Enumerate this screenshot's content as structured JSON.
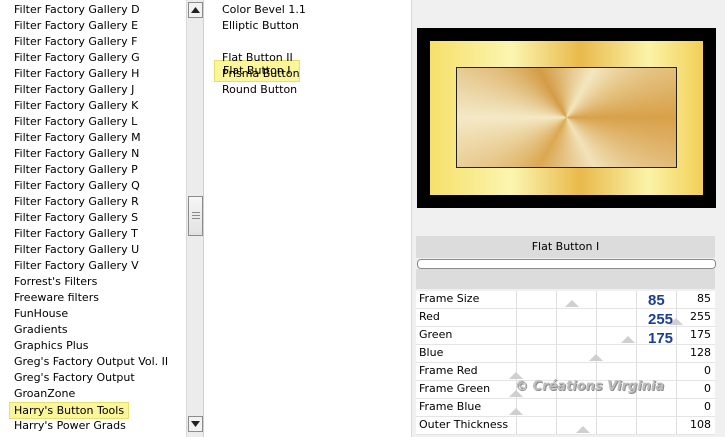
{
  "categories": [
    {
      "label": "Filter Factory Gallery D"
    },
    {
      "label": "Filter Factory Gallery E"
    },
    {
      "label": "Filter Factory Gallery F"
    },
    {
      "label": "Filter Factory Gallery G"
    },
    {
      "label": "Filter Factory Gallery H"
    },
    {
      "label": "Filter Factory Gallery J"
    },
    {
      "label": "Filter Factory Gallery K"
    },
    {
      "label": "Filter Factory Gallery L"
    },
    {
      "label": "Filter Factory Gallery M"
    },
    {
      "label": "Filter Factory Gallery N"
    },
    {
      "label": "Filter Factory Gallery P"
    },
    {
      "label": "Filter Factory Gallery Q"
    },
    {
      "label": "Filter Factory Gallery R"
    },
    {
      "label": "Filter Factory Gallery S"
    },
    {
      "label": "Filter Factory Gallery T"
    },
    {
      "label": "Filter Factory Gallery U"
    },
    {
      "label": "Filter Factory Gallery V"
    },
    {
      "label": "Forrest's Filters"
    },
    {
      "label": "Freeware filters"
    },
    {
      "label": "FunHouse"
    },
    {
      "label": "Gradients"
    },
    {
      "label": "Graphics Plus"
    },
    {
      "label": "Greg's Factory Output Vol. II"
    },
    {
      "label": "Greg's Factory Output"
    },
    {
      "label": "GroanZone"
    },
    {
      "label": "Harry's Button Tools",
      "selected": true
    },
    {
      "label": "Harry's Power Grads"
    }
  ],
  "effects": [
    {
      "label": "Color Bevel 1.1"
    },
    {
      "label": "Elliptic Button"
    },
    {
      "label": "Flat Button I",
      "selected": true
    },
    {
      "label": "Flat Button II"
    },
    {
      "label": "Prisma Button"
    },
    {
      "label": "Round Button"
    }
  ],
  "scrollbar": {
    "up_icon": "arrow-up-icon",
    "down_icon": "arrow-down-icon"
  },
  "preview": {
    "frame_color": "#000000",
    "gold_color": "#e6b84a"
  },
  "filter_title": "Flat Button I",
  "params": [
    {
      "name": "Frame Size",
      "value": "85",
      "slider": 0.35,
      "big": "85"
    },
    {
      "name": "Red",
      "value": "255",
      "slider": 1.0,
      "big": "255"
    },
    {
      "name": "Green",
      "value": "175",
      "slider": 0.7,
      "big": "175"
    },
    {
      "name": "Blue",
      "value": "128",
      "slider": 0.5
    },
    {
      "name": "Frame Red",
      "value": "0",
      "slider": 0.0
    },
    {
      "name": "Frame Green",
      "value": "0",
      "slider": 0.0
    },
    {
      "name": "Frame Blue",
      "value": "0",
      "slider": 0.0
    },
    {
      "name": "Outer Thickness",
      "value": "108",
      "slider": 0.42
    }
  ],
  "watermark": "© Créations Virginia",
  "colors": {
    "highlight": "#fbf59c",
    "value_blue": "#1c3d96"
  }
}
